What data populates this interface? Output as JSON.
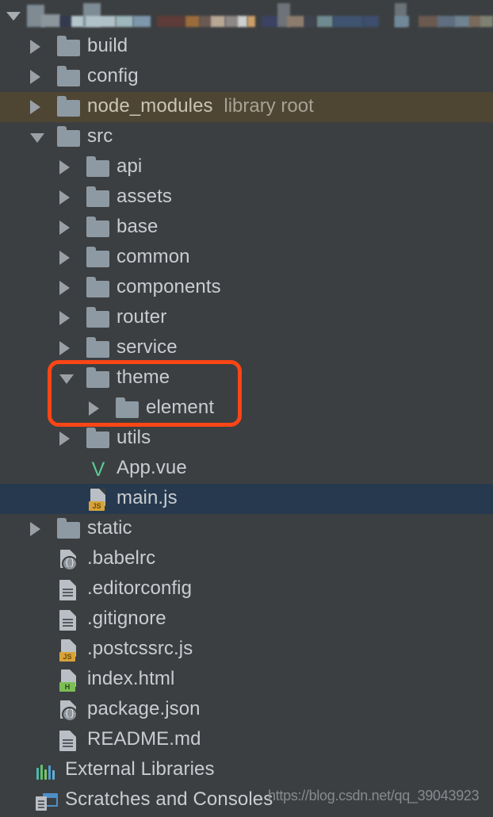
{
  "window": {
    "title": "Project Tool Window",
    "theme": "Darcula",
    "background_color": "#3c3f41",
    "selected_row_color": "#26394f",
    "excluded_row_color": "#4e4633",
    "annotation_color": "#fa4616"
  },
  "root": {
    "expanded": true,
    "name_redacted": true,
    "note": "project root row is pixelated / censored"
  },
  "tree": [
    {
      "label": "build",
      "icon": "folder-icon",
      "level": 1,
      "arrow": "collapsed",
      "state": "normal"
    },
    {
      "label": "config",
      "icon": "folder-icon",
      "level": 1,
      "arrow": "collapsed",
      "state": "normal"
    },
    {
      "label": "node_modules",
      "icon": "folder-icon",
      "level": 1,
      "arrow": "collapsed",
      "state": "library-root",
      "tag": "library root"
    },
    {
      "label": "src",
      "icon": "folder-icon",
      "level": 1,
      "arrow": "expanded",
      "state": "normal"
    },
    {
      "label": "api",
      "icon": "folder-icon",
      "level": 2,
      "arrow": "collapsed",
      "state": "normal"
    },
    {
      "label": "assets",
      "icon": "folder-icon",
      "level": 2,
      "arrow": "collapsed",
      "state": "normal"
    },
    {
      "label": "base",
      "icon": "folder-icon",
      "level": 2,
      "arrow": "collapsed",
      "state": "normal"
    },
    {
      "label": "common",
      "icon": "folder-icon",
      "level": 2,
      "arrow": "collapsed",
      "state": "normal"
    },
    {
      "label": "components",
      "icon": "folder-icon",
      "level": 2,
      "arrow": "collapsed",
      "state": "normal"
    },
    {
      "label": "router",
      "icon": "folder-icon",
      "level": 2,
      "arrow": "collapsed",
      "state": "normal"
    },
    {
      "label": "service",
      "icon": "folder-icon",
      "level": 2,
      "arrow": "collapsed",
      "state": "normal"
    },
    {
      "label": "theme",
      "icon": "folder-icon",
      "level": 2,
      "arrow": "expanded",
      "state": "annotated"
    },
    {
      "label": "element",
      "icon": "folder-icon",
      "level": 3,
      "arrow": "collapsed",
      "state": "annotated"
    },
    {
      "label": "utils",
      "icon": "folder-icon",
      "level": 2,
      "arrow": "collapsed",
      "state": "normal"
    },
    {
      "label": "App.vue",
      "icon": "vue-file-icon",
      "level": 2,
      "arrow": "none",
      "state": "normal"
    },
    {
      "label": "main.js",
      "icon": "js-file-icon",
      "level": 2,
      "arrow": "none",
      "state": "selected",
      "badge": "JS"
    },
    {
      "label": "static",
      "icon": "folder-icon",
      "level": 1,
      "arrow": "collapsed",
      "state": "normal"
    },
    {
      "label": ".babelrc",
      "icon": "json-file-icon",
      "level": 1,
      "arrow": "none",
      "state": "normal"
    },
    {
      "label": ".editorconfig",
      "icon": "text-file-icon",
      "level": 1,
      "arrow": "none",
      "state": "normal"
    },
    {
      "label": ".gitignore",
      "icon": "text-file-icon",
      "level": 1,
      "arrow": "none",
      "state": "normal"
    },
    {
      "label": ".postcssrc.js",
      "icon": "js-file-icon",
      "level": 1,
      "arrow": "none",
      "state": "normal",
      "badge": "JS"
    },
    {
      "label": "index.html",
      "icon": "html-file-icon",
      "level": 1,
      "arrow": "none",
      "state": "normal",
      "badge": "H"
    },
    {
      "label": "package.json",
      "icon": "json-file-icon",
      "level": 1,
      "arrow": "none",
      "state": "normal"
    },
    {
      "label": "README.md",
      "icon": "text-file-icon",
      "level": 1,
      "arrow": "none",
      "state": "normal"
    },
    {
      "label": "External Libraries",
      "icon": "libraries-icon",
      "level": 0,
      "arrow": "none",
      "state": "normal"
    },
    {
      "label": "Scratches and Consoles",
      "icon": "scratches-icon",
      "level": 0,
      "arrow": "none",
      "state": "normal"
    }
  ],
  "annotation": {
    "shape": "rounded-rectangle",
    "color": "#fa4616",
    "covers": [
      "theme",
      "element"
    ]
  },
  "watermark": {
    "text": "https://blog.csdn.net/qq_39043923"
  }
}
